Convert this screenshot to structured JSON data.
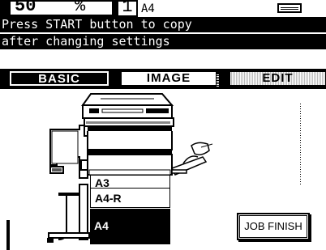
{
  "status": {
    "zoom_value": "50",
    "zoom_unit": "%",
    "copy_count": "1",
    "paper_size": "A4",
    "tray_icon": "paper-tray-icon"
  },
  "messages": {
    "line1": "Press START button to copy",
    "line2": "after changing settings"
  },
  "tabs": [
    {
      "label": "BASIC",
      "active": true
    },
    {
      "label": "IMAGE",
      "active": false
    },
    {
      "label": "EDIT",
      "active": false
    }
  ],
  "trays": [
    {
      "label": "A3",
      "selected": false
    },
    {
      "label": "A4-R",
      "selected": false
    },
    {
      "label": "A4",
      "selected": true
    }
  ],
  "buttons": {
    "job_finish": "JOB FINISH"
  },
  "machine_illustration": "copier-with-finisher-illustration"
}
